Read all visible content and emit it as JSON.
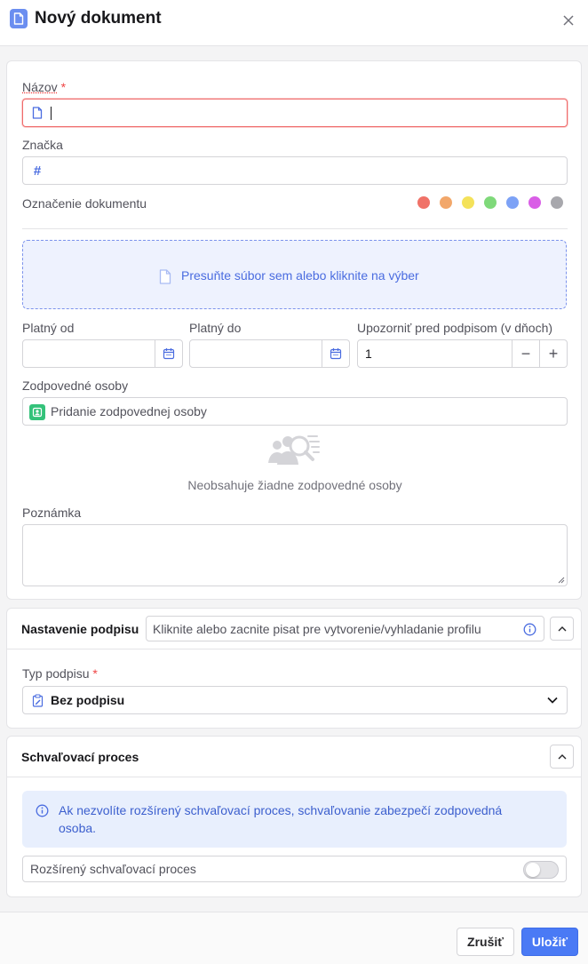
{
  "dialog": {
    "title": "Nový dokument",
    "close_icon": "close-icon",
    "title_icon": "document-icon"
  },
  "form": {
    "name": {
      "label": "Názov",
      "required_mark": "*",
      "value": "",
      "icon": "document-icon"
    },
    "mark": {
      "label": "Značka",
      "value": "",
      "icon": "hash-icon"
    },
    "color_tag": {
      "label": "Označenie dokumentu",
      "colors": [
        "#f07268",
        "#f2a76a",
        "#f4e25a",
        "#7fd97a",
        "#7da2f6",
        "#d95ee6",
        "#a8a8ad"
      ]
    },
    "dropzone": {
      "text": "Presuňte súbor sem alebo kliknite na výber",
      "icon": "file-icon"
    },
    "valid_from": {
      "label": "Platný od",
      "value": "",
      "icon": "calendar-icon"
    },
    "valid_to": {
      "label": "Platný do",
      "value": "",
      "icon": "calendar-icon"
    },
    "notify": {
      "label": "Upozorniť pred podpisom (v dňoch)",
      "value": "1",
      "minus": "−",
      "plus": "+"
    },
    "responsible": {
      "label": "Zodpovedné osoby",
      "placeholder": "Pridanie zodpovednej osoby",
      "empty_text": "Neobsahuje žiadne zodpovedné osoby",
      "empty_icon": "people-search-icon"
    },
    "note": {
      "label": "Poznámka",
      "value": ""
    }
  },
  "signature": {
    "title": "Nastavenie podpisu",
    "profile_placeholder": "Kliknite alebo zacnite pisat pre vytvorenie/vyhladanie profilu",
    "type_label": "Typ podpisu",
    "required_mark": "*",
    "type_value": "Bez podpisu"
  },
  "approval": {
    "title": "Schvaľovací proces",
    "info_text": "Ak nezvolíte rozšírený schvaľovací proces, schvaľovanie zabezpečí zodpovedná osoba.",
    "extended_label": "Rozšírený schvaľovací proces",
    "extended_enabled": false
  },
  "footer": {
    "cancel_label": "Zrušiť",
    "save_label": "Uložiť"
  }
}
